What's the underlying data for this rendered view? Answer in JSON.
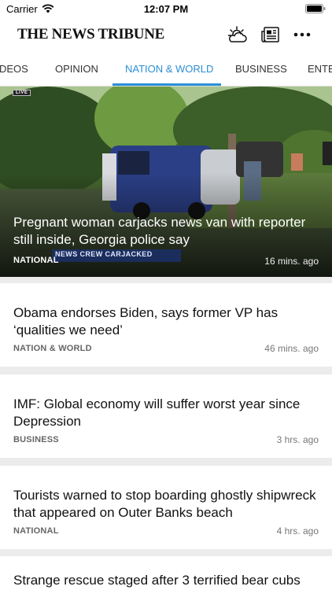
{
  "status_bar": {
    "carrier": "Carrier",
    "time": "12:07 PM"
  },
  "header": {
    "brand": "THE NEWS TRIBUNE"
  },
  "tabs": [
    "DEOS",
    "OPINION",
    "NATION & WORLD",
    "BUSINESS",
    "ENTE"
  ],
  "active_tab": "NATION & WORLD",
  "hero": {
    "live": "LIVE",
    "headline": "Pregnant woman carjacks news van with reporter still inside, Georgia police say",
    "chyron": "NEWS CREW CARJACKED",
    "category": "NATIONAL",
    "time": "16 mins. ago"
  },
  "stories": [
    {
      "headline": "Obama endorses Biden, says former VP has ‘qualities we need’",
      "category": "NATION & WORLD",
      "time": "46 mins. ago"
    },
    {
      "headline": "IMF: Global economy will suffer worst year since Depression",
      "category": "BUSINESS",
      "time": "3 hrs. ago"
    },
    {
      "headline": "Tourists warned to stop boarding ghostly shipwreck that appeared on Outer Banks beach",
      "category": "NATIONAL",
      "time": "4 hrs. ago"
    },
    {
      "headline": "Strange rescue staged after 3 terrified bear cubs",
      "category": "",
      "time": ""
    }
  ],
  "colors": {
    "accent": "#2a8fd6",
    "background": "#ececec",
    "card": "#ffffff"
  },
  "icons": [
    "wifi-icon",
    "battery-icon",
    "weather-icon",
    "e-edition-icon",
    "more-icon"
  ]
}
